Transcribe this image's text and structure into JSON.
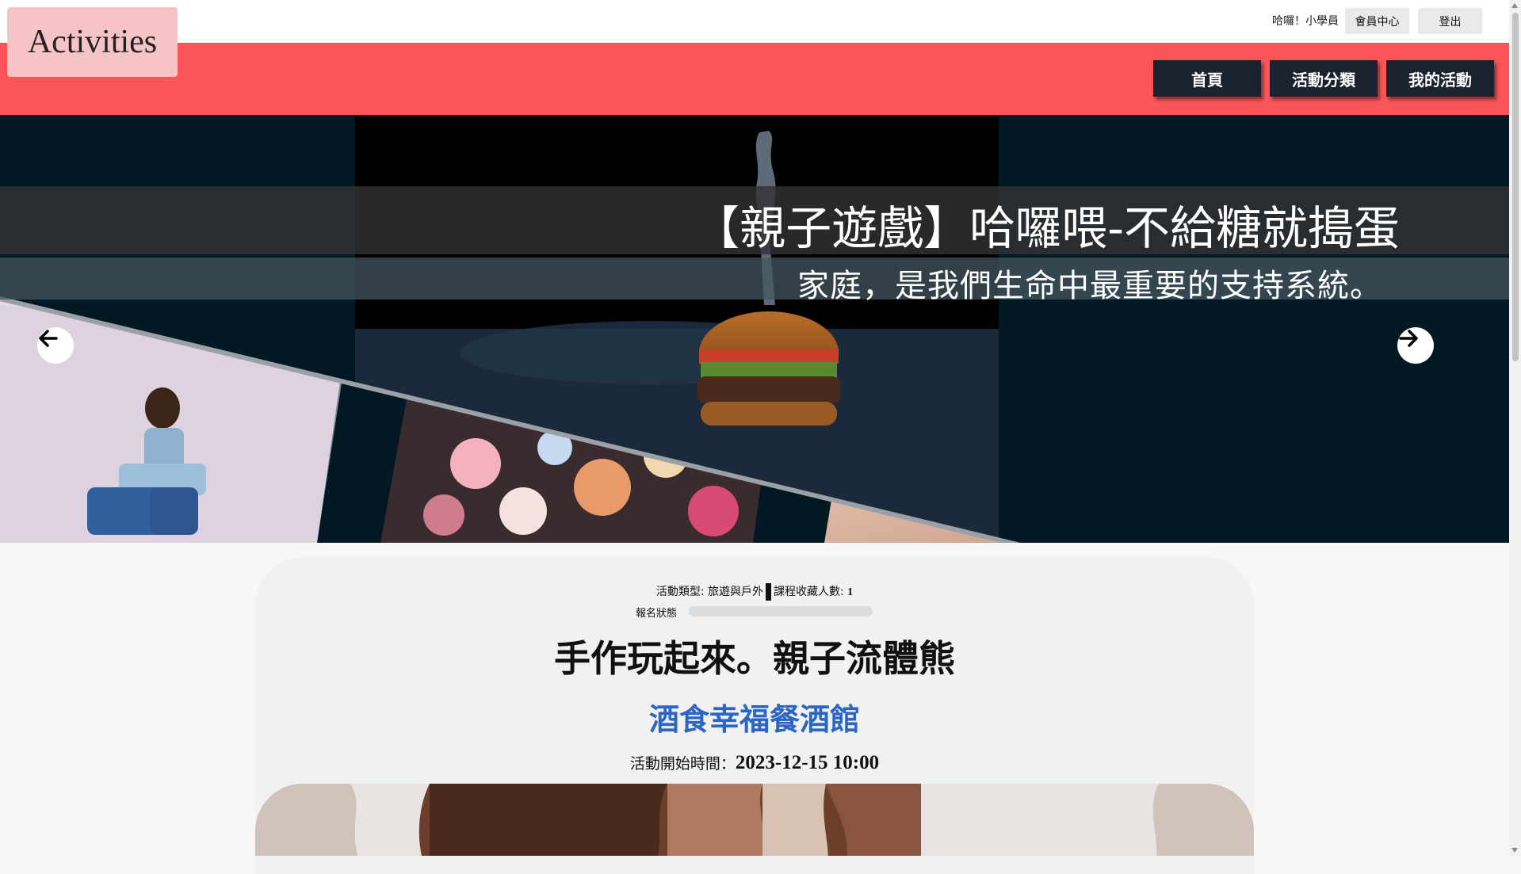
{
  "topbar": {
    "greeting": "哈囉！小學員",
    "member_center_label": "會員中心",
    "logout_label": "登出"
  },
  "header": {
    "logo_text": "Activities",
    "nav": {
      "home": "首頁",
      "categories": "活動分類",
      "my_activities": "我的活動"
    },
    "brand_color": "#fa5559"
  },
  "hero": {
    "title": "【親子遊戲】哈囉喂-不給糖就搗蛋",
    "subtitle": "家庭，是我們生命中最重要的支持系統。",
    "prev_icon": "arrow-left-icon",
    "next_icon": "arrow-right-icon"
  },
  "activity": {
    "category_label": "活動類型: ",
    "category_value": "旅遊與戶外",
    "favorites_label": "課程收藏人數: ",
    "favorites_count": "1",
    "status_label": "報名狀態",
    "status_fill": 0.02,
    "title": "手作玩起來。親子流體熊",
    "venue": "酒食幸福餐酒館",
    "start_label": "活動開始時間：",
    "start_time": "2023-12-15 10:00",
    "venue_color": "#2b66c5"
  }
}
